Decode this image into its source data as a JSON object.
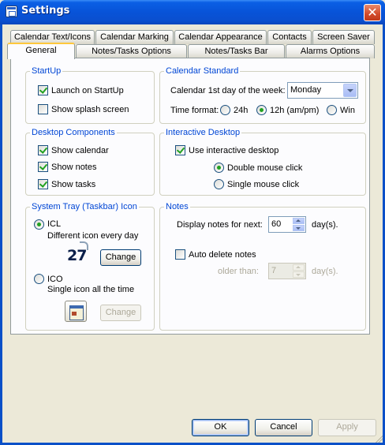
{
  "window": {
    "title": "Settings",
    "close_glyph": "✕"
  },
  "tabs_row1": [
    "Calendar Text/Icons",
    "Calendar Marking",
    "Calendar Appearance",
    "Contacts",
    "Screen Saver"
  ],
  "tabs_row2": [
    "General",
    "Notes/Tasks Options",
    "Notes/Tasks Bar",
    "Alarms Options"
  ],
  "active_tab": "General",
  "startup": {
    "title": "StartUp",
    "launch": {
      "label": "Launch on StartUp",
      "checked": true
    },
    "splash": {
      "label": "Show splash screen",
      "checked": false
    }
  },
  "calendar_standard": {
    "title": "Calendar Standard",
    "first_day_label": "Calendar 1st day of the week:",
    "first_day_value": "Monday",
    "time_format_label": "Time format:",
    "options": [
      {
        "label": "24h",
        "selected": false
      },
      {
        "label": "12h (am/pm)",
        "selected": true
      },
      {
        "label": "Win",
        "selected": false
      }
    ]
  },
  "desktop_components": {
    "title": "Desktop Components",
    "items": [
      {
        "label": "Show calendar",
        "checked": true
      },
      {
        "label": "Show notes",
        "checked": true
      },
      {
        "label": "Show tasks",
        "checked": true
      }
    ]
  },
  "interactive_desktop": {
    "title": "Interactive Desktop",
    "use": {
      "label": "Use interactive desktop",
      "checked": true
    },
    "options": [
      {
        "label": "Double mouse click",
        "selected": true
      },
      {
        "label": "Single mouse click",
        "selected": false
      }
    ]
  },
  "tray": {
    "title": "System Tray (Taskbar) Icon",
    "icl": {
      "label": "ICL",
      "desc": "Different icon every day",
      "selected": true,
      "preview": "27"
    },
    "ico": {
      "label": "ICO",
      "desc": "Single icon all the time",
      "selected": false
    },
    "change_label": "Change"
  },
  "notes": {
    "title": "Notes",
    "display_label": "Display notes for next:",
    "display_value": "60",
    "display_unit": "day(s).",
    "auto_delete": {
      "label": "Auto delete notes",
      "checked": false
    },
    "older_label": "older than:",
    "older_value": "7",
    "older_unit": "day(s)."
  },
  "buttons": {
    "ok": "OK",
    "cancel": "Cancel",
    "apply": "Apply"
  },
  "colors": {
    "titlebar": "#0a53d8",
    "group_title": "#0046d5",
    "check": "#21a121",
    "face": "#ece9d8"
  }
}
